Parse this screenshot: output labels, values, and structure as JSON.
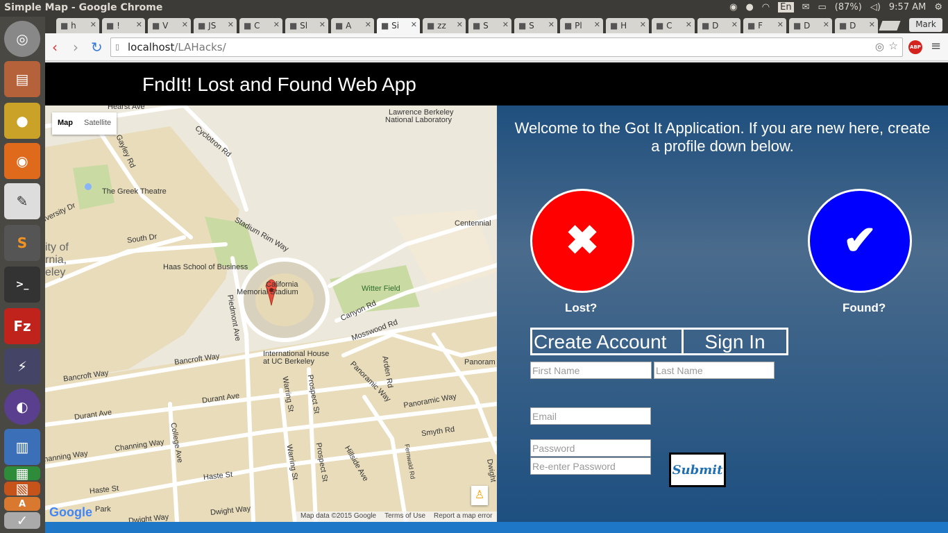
{
  "os": {
    "window_title": "Simple Map - Google Chrome",
    "keyboard": "En",
    "battery": "(87%)",
    "clock": "9:57 AM",
    "user": "Mark"
  },
  "browser": {
    "tabs": [
      {
        "label": "h",
        "active": false
      },
      {
        "label": "!",
        "active": false
      },
      {
        "label": "V",
        "active": false
      },
      {
        "label": "JS",
        "active": false
      },
      {
        "label": "C",
        "active": false
      },
      {
        "label": "Sl",
        "active": false
      },
      {
        "label": "A",
        "active": false
      },
      {
        "label": "Si",
        "active": true
      },
      {
        "label": "zz",
        "active": false
      },
      {
        "label": "S",
        "active": false
      },
      {
        "label": "S",
        "active": false
      },
      {
        "label": "Pl",
        "active": false
      },
      {
        "label": "H",
        "active": false
      },
      {
        "label": "C",
        "active": false
      },
      {
        "label": "D",
        "active": false
      },
      {
        "label": "F",
        "active": false
      },
      {
        "label": "D",
        "active": false
      },
      {
        "label": "D",
        "active": false
      }
    ],
    "url_host": "localhost",
    "url_path": "/LAHacks/",
    "abp": "ABP"
  },
  "app": {
    "header_title": "FndIt! Lost and Found Web App",
    "welcome": "Welcome to the Got It Application. If you are new here, create a profile down below.",
    "lost_label": "Lost?",
    "found_label": "Found?",
    "tab_create": "Create Account",
    "tab_signin": "Sign In",
    "first_name_placeholder": "First Name",
    "last_name_placeholder": "Last Name",
    "email_placeholder": "Email",
    "password_placeholder": "Password",
    "reenter_placeholder": "Re-enter Password",
    "submit_label": "Submit",
    "colors": {
      "lost": "#ff0000",
      "found": "#0000ff",
      "header": "#000000"
    }
  },
  "map": {
    "type_map": "Map",
    "type_satellite": "Satellite",
    "labels": {
      "hearst": "Hearst Ave",
      "lbnl1": "Lawrence Berkeley",
      "lbnl2": "National Laboratory",
      "cyclotron": "Cyclotron Rd",
      "gayley": "Gayley Rd",
      "greek": "The Greek Theatre",
      "university": "Iversity Dr",
      "city": "ity of",
      "rnia": "rnia,",
      "eley": "eley",
      "south": "South Dr",
      "stadium_rim": "Stadium Rim Way",
      "centennial": "Centennial",
      "haas": "Haas School of Business",
      "california": "California",
      "memorial": "Memorial Stadium",
      "witter": "Witter Field",
      "canyon": "Canyon Rd",
      "piedmont": "Piedmont Ave",
      "mosswood": "Mosswood Rd",
      "bancroft1": "Bancroft Way",
      "bancroft2": "Bancroft Way",
      "ihouse1": "International House",
      "ihouse2": "at UC Berkeley",
      "panoramic1": "Panoramic Way",
      "panoramic2": "Panoramic Way",
      "panoramic3": "Panoram",
      "arden": "Arden Rd",
      "durant1": "Durant Ave",
      "durant2": "Durant Ave",
      "warring1": "Warring St",
      "prospect1": "Prospect St",
      "channing1": "hanning Way",
      "channing2": "Channing Way",
      "college": "College Ave",
      "warring2": "Warring St",
      "prospect2": "Prospect St",
      "smyth": "Smyth Rd",
      "hillside": "Hillside Ave",
      "fernwald": "Fernwald Rd",
      "haste1": "Haste St",
      "haste2": "Haste St",
      "park": "Park",
      "dwight1": "Dwight Way",
      "dwight2": "Dwight Way",
      "dwight3": "Dwight"
    },
    "footer_data": "Map data ©2015 Google",
    "footer_terms": "Terms of Use",
    "footer_report": "Report a map error",
    "google": "Google"
  }
}
